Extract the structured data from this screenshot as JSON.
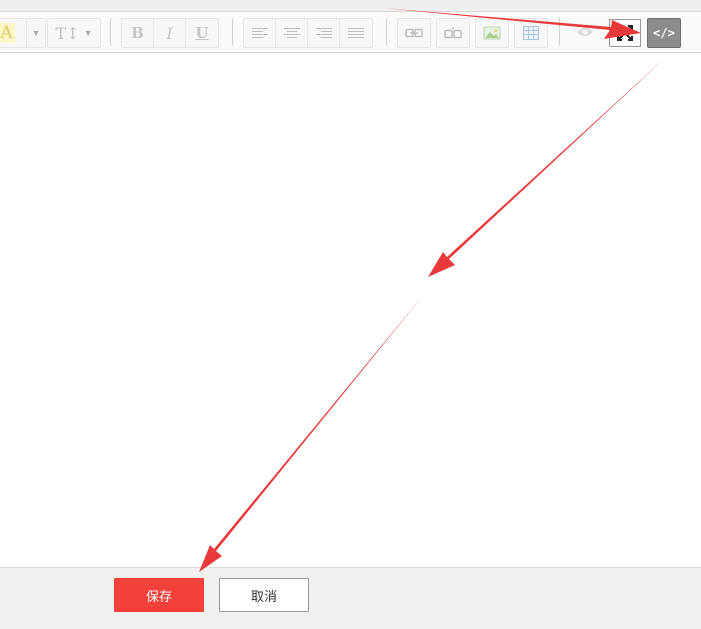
{
  "toolbar": {
    "font_color_glyph": "A",
    "font_size_glyph": "T↕",
    "bold_glyph": "B",
    "italic_glyph": "I",
    "underline_glyph": "U",
    "source_glyph": "</>",
    "icons": {
      "font_color": "font-color-icon",
      "font_size": "font-size-icon",
      "bold": "bold-icon",
      "italic": "italic-icon",
      "underline": "underline-icon",
      "align_left": "align-left-icon",
      "align_center": "align-center-icon",
      "align_right": "align-right-icon",
      "align_justify": "align-justify-icon",
      "link": "link-icon",
      "unlink": "unlink-icon",
      "image": "image-icon",
      "table": "table-icon",
      "preview": "eye-icon",
      "fullscreen": "fullscreen-icon",
      "source": "code-icon"
    },
    "source_active_color": "#8c8c8c"
  },
  "editor": {
    "content": ""
  },
  "footer": {
    "save_label": "保存",
    "cancel_label": "取消",
    "save_color": "#f4403a"
  },
  "annotation": {
    "arrow_color": "#e8393a"
  }
}
